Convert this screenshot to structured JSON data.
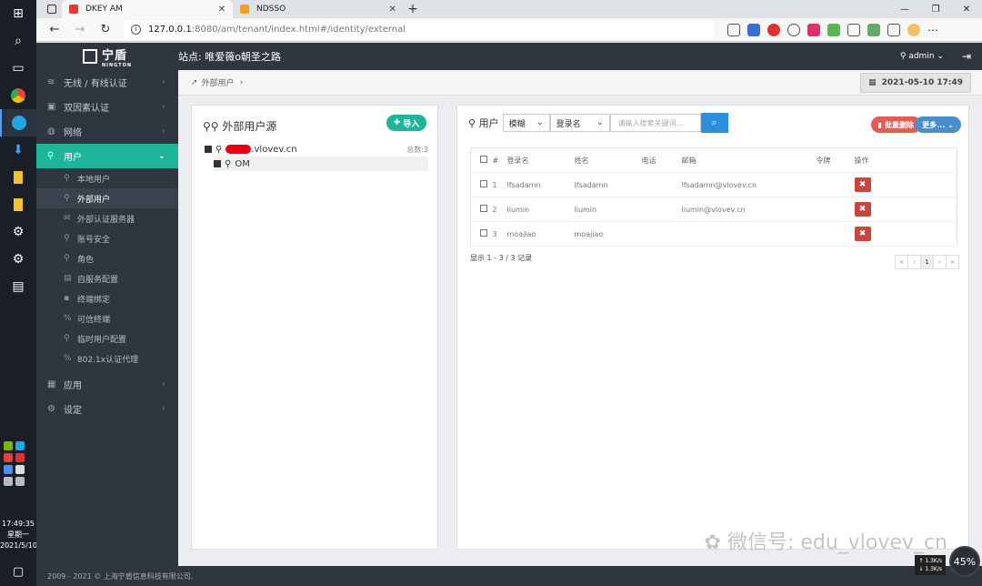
{
  "taskbar": {
    "time": "17:49:35",
    "weekday": "星期一",
    "date": "2021/5/10"
  },
  "browser": {
    "tabs": [
      {
        "label": "DKEY AM",
        "active": true
      },
      {
        "label": "NDSSO",
        "active": false
      }
    ],
    "url_host": "127.0.0.1",
    "url_path": ":8080/am/tenant/index.html#/identity/external"
  },
  "header": {
    "logo_text": "宁盾",
    "logo_sub": "NINGTON",
    "site_label": "站点: 唯爱薇o朝圣之路",
    "user": "admin"
  },
  "sidebar": {
    "items": [
      {
        "label": "无线 / 有线认证",
        "icon": "wifi-icon"
      },
      {
        "label": "双因素认证",
        "icon": "lock-icon"
      },
      {
        "label": "网络",
        "icon": "globe-icon"
      },
      {
        "label": "用户",
        "icon": "user-icon",
        "active": true
      },
      {
        "label": "应用",
        "icon": "apps-icon"
      },
      {
        "label": "设定",
        "icon": "gear-icon"
      }
    ],
    "sub_items": [
      {
        "label": "本地用户"
      },
      {
        "label": "外部用户",
        "active": true
      },
      {
        "label": "外部认证服务器"
      },
      {
        "label": "账号安全"
      },
      {
        "label": "角色"
      },
      {
        "label": "自服务配置"
      },
      {
        "label": "终端绑定"
      },
      {
        "label": "可信终端"
      },
      {
        "label": "临时用户配置"
      },
      {
        "label": "802.1x认证代理"
      }
    ]
  },
  "breadcrumb": "外部用户",
  "datetime": "2021-05-10 17:49",
  "left_panel": {
    "title": "外部用户源",
    "import_label": "导入",
    "root_suffix": ".vlovev.cn",
    "total": "总数:3",
    "child": "OM"
  },
  "right_panel": {
    "title": "用户",
    "match_select": "模糊",
    "field_select": "登录名",
    "search_placeholder": "请输入搜索关键词...",
    "batch_delete": "批量删除",
    "more": "更多...",
    "columns": [
      "#",
      "登录名",
      "姓名",
      "电话",
      "邮箱",
      "令牌",
      "操作"
    ],
    "rows": [
      {
        "no": "1",
        "login": "lfsadamn",
        "name": "lfsadamn",
        "phone": "",
        "email": "lfsadamn@vlovev.cn",
        "token": ""
      },
      {
        "no": "2",
        "login": "liumin",
        "name": "liumin",
        "phone": "",
        "email": "liumin@vlovev.cn",
        "token": ""
      },
      {
        "no": "3",
        "login": "moajiao",
        "name": "moajiao",
        "phone": "",
        "email": "",
        "token": ""
      }
    ],
    "page_info": "显示 1 - 3 / 3 记录",
    "pager": [
      "«",
      "‹",
      "1",
      "›",
      "»"
    ]
  },
  "footer": "2009 - 2021 © 上海宁盾信息科技有限公司.",
  "overlay": {
    "watermark": "微信号: edu_vlovev_cn",
    "speed_up": "1.3",
    "speed_down": "1.3",
    "speed_unit": "K/s",
    "gauge": "45%"
  }
}
